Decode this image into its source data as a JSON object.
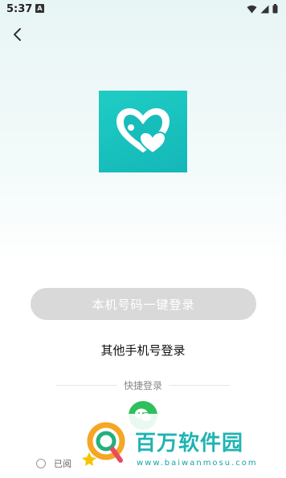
{
  "status_bar": {
    "time": "5:37",
    "notification_letter": "A"
  },
  "main": {
    "one_click_login_label": "本机号码一键登录",
    "other_phone_login_label": "其他手机号登录",
    "quick_login_label": "快捷登录",
    "agreement_text": "已阅"
  },
  "watermark": {
    "title": "百万软件园",
    "url": "www.baiwanmosu.com"
  },
  "icons": {
    "back": "back-arrow-icon",
    "app_logo": "hearts-logo-icon",
    "wechat": "wechat-icon"
  },
  "colors": {
    "brand": "#1fc4c0",
    "button_disabled": "#d9d9d9",
    "wechat": "#2fbf5c"
  }
}
